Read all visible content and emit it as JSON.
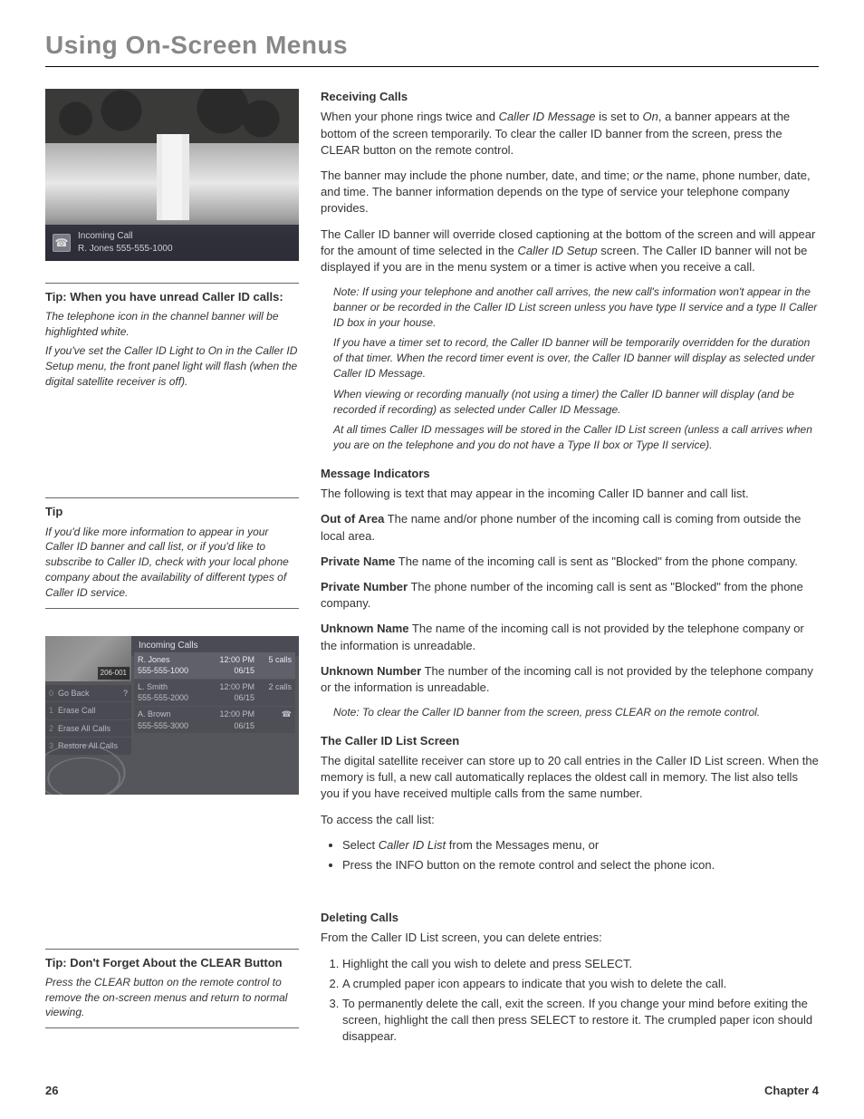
{
  "title": "Using On-Screen Menus",
  "left": {
    "screenshot1": {
      "banner_line1": "Incoming Call",
      "banner_line2": "R. Jones   555-555-1000"
    },
    "tip1": {
      "heading": "Tip: When you have unread Caller ID calls:",
      "p1": "The telephone icon in the channel banner will be highlighted white.",
      "p2": "If you've set the Caller ID Light to On in the Caller ID Setup menu, the front panel light will flash (when the digital satellite receiver is off)."
    },
    "tip2": {
      "heading": "Tip",
      "p1": "If you'd like more information to appear in your Caller ID banner and call list, or if you'd like to subscribe to Caller ID, check with your local phone company about the availability of different types of Caller ID service."
    },
    "screenshot2": {
      "channel": "206-001",
      "header": "Incoming Calls",
      "sidebar": [
        {
          "n": "0",
          "label": "Go Back",
          "suffix": "?"
        },
        {
          "n": "1",
          "label": "Erase Call"
        },
        {
          "n": "2",
          "label": "Erase All Calls"
        },
        {
          "n": "3",
          "label": "Restore All Calls"
        }
      ],
      "rows": [
        {
          "name": "R. Jones",
          "phone": "555-555-1000",
          "time": "12:00 PM",
          "date": "06/15",
          "count": "5 calls"
        },
        {
          "name": "L. Smith",
          "phone": "555-555-2000",
          "time": "12:00 PM",
          "date": "06/15",
          "count": "2 calls"
        },
        {
          "name": "A. Brown",
          "phone": "555-555-3000",
          "time": "12:00 PM",
          "date": "06/15",
          "count": ""
        }
      ]
    },
    "tip3": {
      "heading": "Tip: Don't Forget About the CLEAR Button",
      "p1": "Press the CLEAR button on the remote control to remove the on-screen menus and return to normal viewing."
    }
  },
  "right": {
    "receiving": {
      "heading": "Receiving Calls",
      "p1_a": "When your phone rings twice and ",
      "p1_b": "Caller ID Message",
      "p1_c": " is set to ",
      "p1_d": "On",
      "p1_e": ", a banner appears at the bottom of the screen temporarily. To clear the caller ID banner from the screen, press the CLEAR button on the remote control.",
      "p2_a": "The banner may include the phone number, date, and time; ",
      "p2_b": "or",
      "p2_c": " the name, phone number, date, and time. The banner information depends on the type of service your telephone company provides.",
      "p3_a": "The Caller ID banner will override closed captioning at the bottom of the screen and will appear for the amount of time selected in the ",
      "p3_b": "Caller ID Setup",
      "p3_c": " screen. The Caller ID banner will not be displayed if you are in the menu system or a timer is active when you receive a call.",
      "n1": "Note: If using your telephone and another call arrives, the new call's information won't appear in the banner or be recorded in the Caller ID List screen unless you have type II  service and a type II Caller ID box in your house.",
      "n2": "If you have a timer set to record, the Caller ID banner will be temporarily overridden for the duration of that timer. When the record timer event is over, the Caller ID banner will display as selected under Caller ID Message.",
      "n3": "When viewing or recording manually (not using a timer) the Caller ID banner will display (and be recorded if recording) as selected under Caller ID Message.",
      "n4": "At all times Caller ID messages will be stored in the Caller ID List screen (unless a call arrives when you are on the telephone and you do not have a Type II box or Type II service)."
    },
    "indicators": {
      "heading": "Message Indicators",
      "intro": "The following is text that may appear in the incoming Caller ID banner and call list.",
      "i1_t": "Out of Area",
      "i1_d": "   The name and/or phone number of the incoming call is coming from outside the local area.",
      "i2_t": "Private Name",
      "i2_d": "   The name of the incoming call is sent as \"Blocked\" from the phone company.",
      "i3_t": "Private Number",
      "i3_d": "   The phone number of the incoming call is sent as \"Blocked\" from the phone company.",
      "i4_t": "Unknown Name",
      "i4_d": "   The name of the incoming call is not provided by the telephone company or the information is unreadable.",
      "i5_t": "Unknown Number",
      "i5_d": "   The number of the incoming call is not provided by the telephone company or the information is unreadable.",
      "note": "Note: To clear the Caller ID banner from the screen, press CLEAR on the remote control."
    },
    "listscreen": {
      "heading": "The Caller ID List Screen",
      "p1": "The digital satellite receiver can store up to 20 call entries in the Caller ID List  screen. When the memory is full, a new call automatically replaces the oldest call in memory. The list also tells you if you have received multiple calls from the same number.",
      "p2": "To access the call list:",
      "b1_a": "Select ",
      "b1_b": "Caller ID List",
      "b1_c": "  from the Messages menu, or",
      "b2": "Press the INFO button on the remote control and select the phone icon."
    },
    "deleting": {
      "heading": "Deleting Calls",
      "intro": "From the Caller ID List screen, you can delete entries:",
      "s1": "Highlight the call you wish to delete and press SELECT.",
      "s2": "A crumpled paper icon appears to indicate that you wish to delete the call.",
      "s3": "To permanently delete the call, exit the screen. If you change your mind before exiting the screen, highlight the call then press SELECT to restore it. The crumpled paper icon should disappear."
    }
  },
  "footer": {
    "page": "26",
    "chapter": "Chapter 4"
  }
}
